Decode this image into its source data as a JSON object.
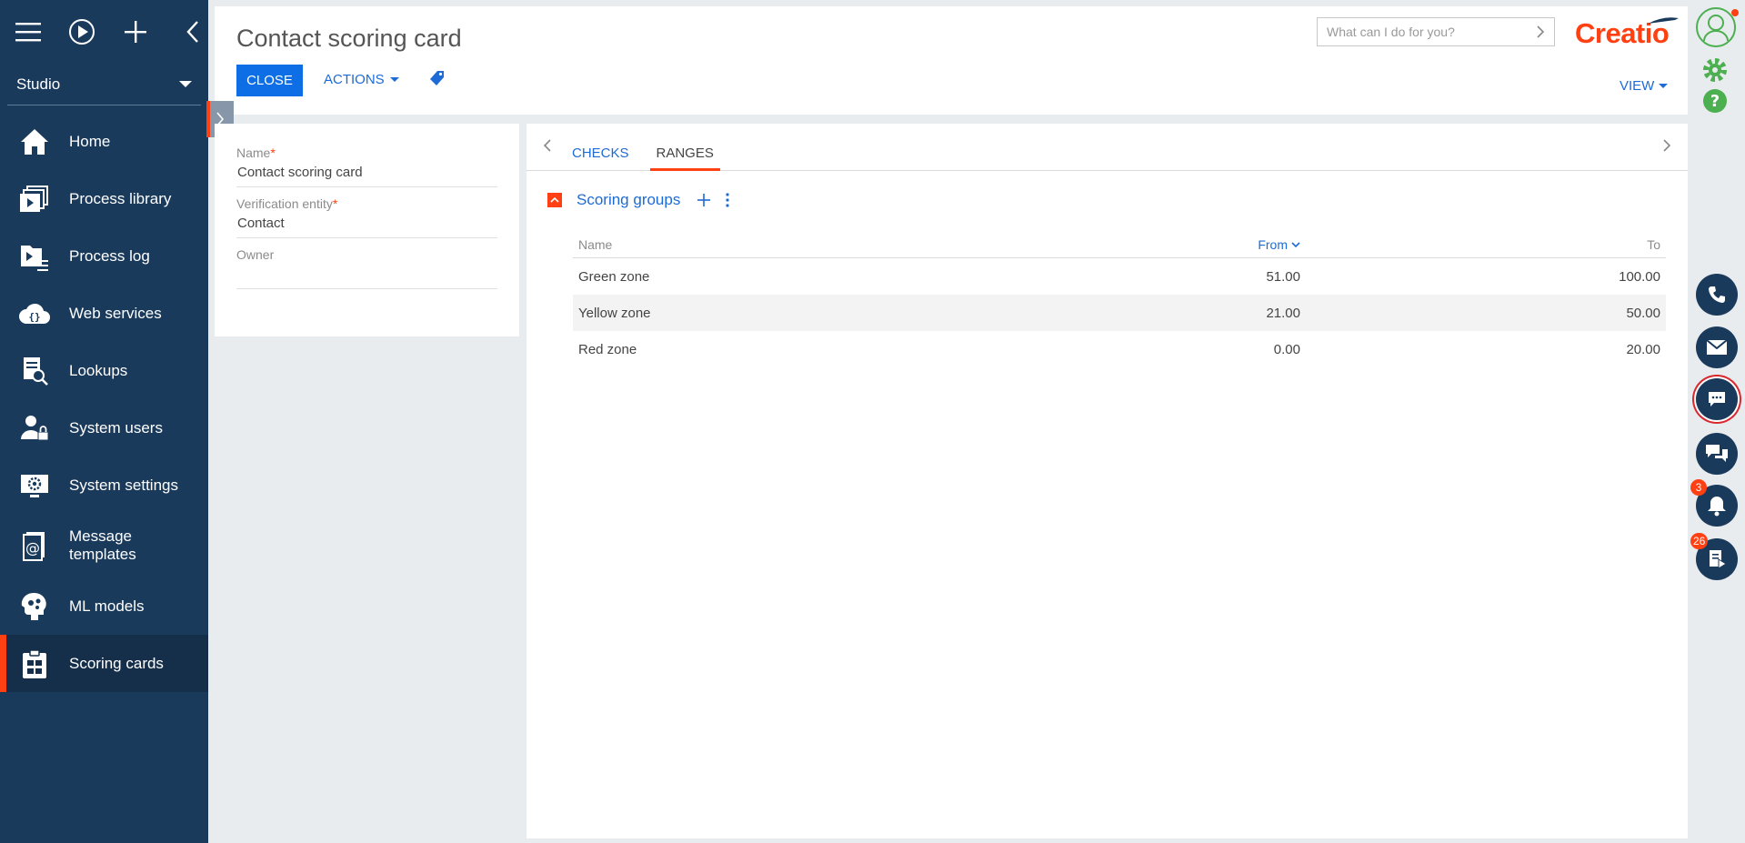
{
  "sidebar": {
    "workspace": "Studio",
    "items": [
      {
        "label": "Home",
        "icon": "home-icon"
      },
      {
        "label": "Process library",
        "icon": "process-library-icon"
      },
      {
        "label": "Process log",
        "icon": "process-log-icon"
      },
      {
        "label": "Web services",
        "icon": "web-services-icon"
      },
      {
        "label": "Lookups",
        "icon": "lookups-icon"
      },
      {
        "label": "System users",
        "icon": "system-users-icon"
      },
      {
        "label": "System settings",
        "icon": "system-settings-icon"
      },
      {
        "label": "Message templates",
        "icon": "message-templates-icon"
      },
      {
        "label": "ML models",
        "icon": "ml-models-icon"
      },
      {
        "label": "Scoring cards",
        "icon": "scoring-cards-icon",
        "active": true
      }
    ]
  },
  "header": {
    "title": "Contact scoring card",
    "close_label": "CLOSE",
    "actions_label": "ACTIONS",
    "view_label": "VIEW",
    "search_placeholder": "What can I do for you?",
    "logo": "Creatio"
  },
  "form": {
    "fields": [
      {
        "label": "Name",
        "required": "*",
        "value": "Contact scoring card"
      },
      {
        "label": "Verification entity",
        "required": "*",
        "value": "Contact"
      },
      {
        "label": "Owner",
        "required": "",
        "value": ""
      }
    ]
  },
  "tabs": [
    {
      "label": "CHECKS",
      "active": false
    },
    {
      "label": "RANGES",
      "active": true
    }
  ],
  "scoring_groups": {
    "title": "Scoring groups",
    "columns": {
      "name": "Name",
      "from": "From",
      "to": "To"
    },
    "rows": [
      {
        "name": "Green zone",
        "from": "51.00",
        "to": "100.00"
      },
      {
        "name": "Yellow zone",
        "from": "21.00",
        "to": "50.00"
      },
      {
        "name": "Red zone",
        "from": "0.00",
        "to": "20.00"
      }
    ]
  },
  "right_panel": {
    "notifications_count": "3",
    "feed_count": "26"
  },
  "colors": {
    "sidebar_bg": "#1a3a5c",
    "accent": "#ff4013",
    "link": "#1d6bd6",
    "primary_button": "#0e6ee6",
    "ok_green": "#4caf50"
  }
}
